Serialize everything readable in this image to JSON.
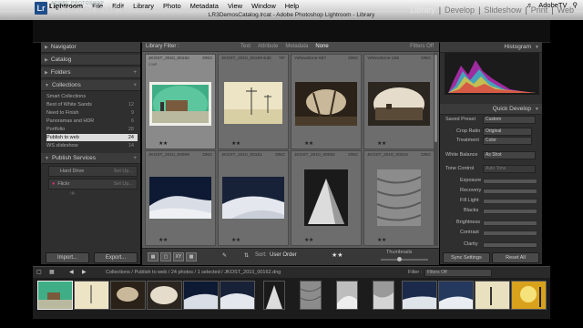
{
  "menubar": {
    "apple": "",
    "app": "Lightroom",
    "items": [
      "File",
      "Edit",
      "Library",
      "Photo",
      "Metadata",
      "View",
      "Window",
      "Help"
    ],
    "right_label": "AdobeTV"
  },
  "window_title": "LR3DemosCatalog.lrcat - Adobe Photoshop Lightroom - Library",
  "identity": {
    "logo": "Lr",
    "adobe": "ADOBE PHOTOSHOP",
    "brand": "LIGHTROOM 3"
  },
  "modules": {
    "library": "Library",
    "develop": "Develop",
    "slideshow": "Slideshow",
    "print": "Print",
    "web": "Web",
    "sep": "|"
  },
  "left_panel": {
    "navigator": "Navigator",
    "catalog": "Catalog",
    "folders": "Folders",
    "collections": "Collections",
    "collection_items": [
      {
        "label": "Smart Collections",
        "count": ""
      },
      {
        "label": "Best of White Sands",
        "count": "12"
      },
      {
        "label": "Need to Finish",
        "count": "9"
      },
      {
        "label": "Panoramas and HDR",
        "count": "6"
      },
      {
        "label": "Portfolio",
        "count": "28"
      },
      {
        "label": "Publish to web",
        "count": "24"
      },
      {
        "label": "WS slideshow",
        "count": "14"
      }
    ],
    "publish_services": "Publish Services",
    "services": [
      {
        "label": "Hard Drive",
        "action": "Set Up..."
      },
      {
        "label": "Flickr",
        "action": "Set Up..."
      }
    ],
    "import": "Import...",
    "export": "Export..."
  },
  "filter_bar": {
    "label": "Library Filter :",
    "options": [
      "Text",
      "Attribute",
      "Metadata",
      "None"
    ],
    "filters_off": "Filters Off"
  },
  "grid": [
    {
      "file": "JKOST_2010_00162",
      "format": "DNG",
      "size": "2 MP",
      "stars": "★★"
    },
    {
      "file": "JKOST_2010_00159-Edit",
      "format": "TIF",
      "size": "",
      "stars": "★★"
    },
    {
      "file": "Yellowstone-857",
      "format": "DNG",
      "size": "",
      "stars": "★★"
    },
    {
      "file": "Yellowstone-106",
      "format": "DNG",
      "size": "",
      "stars": "★★"
    },
    {
      "file": "JKOST_2010_00009",
      "format": "DNG",
      "size": "",
      "stars": "★★"
    },
    {
      "file": "JKOST_2010_00151",
      "format": "DNG",
      "size": "",
      "stars": "★★"
    },
    {
      "file": "JKOST_2010_00082",
      "format": "DNG",
      "size": "",
      "stars": "★★"
    },
    {
      "file": "JKOST_2010_00016",
      "format": "DNG",
      "size": "",
      "stars": "★★"
    }
  ],
  "toolbar": {
    "sort_label": "Sort:",
    "sort_value": "User Order",
    "stars": "★★",
    "thumbnails": "Thumbnails"
  },
  "right_panel": {
    "histogram": "Histogram",
    "quick_develop": "Quick Develop",
    "saved_preset_label": "Saved Preset",
    "saved_preset": "Custom",
    "crop_ratio_label": "Crop Ratio",
    "crop_ratio": "Original",
    "treatment_label": "Treatment",
    "treatment": "Color",
    "wb_label": "White Balance",
    "wb": "As Shot",
    "tone_label": "Tone Control",
    "tone_action": "Auto Tone",
    "sliders": [
      "Exposure",
      "Recovery",
      "Fill Light",
      "Blacks",
      "Brightness",
      "Contrast",
      "Clarity"
    ],
    "sync": "Sync Settings",
    "reset": "Reset All"
  },
  "filmstrip": {
    "path": "Collections / Publish to web / 24 photos / 1 selected / JKOST_2010_00162.dng",
    "filter_label": "Filter :",
    "filter_value": "Filters Off"
  }
}
